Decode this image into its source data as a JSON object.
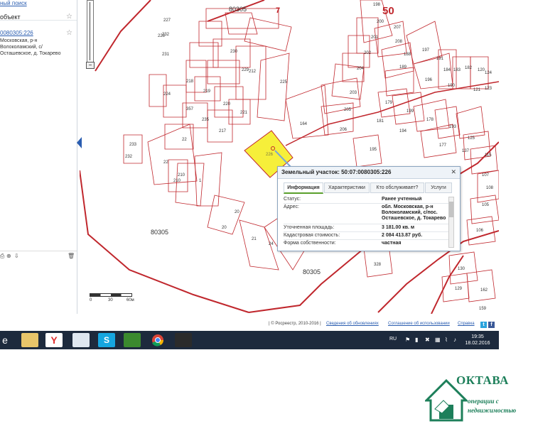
{
  "sidebar": {
    "top_link": "ный поиск",
    "section_title": "объект",
    "object_link": "0080305:226",
    "object_address": "Московская, р-н Волоколамский, с/ Осташевское, д. Токарево",
    "footer_icon_names": [
      "print-icon",
      "zoom-icon",
      "export-icon",
      "delete-icon"
    ]
  },
  "map": {
    "parcels": [
      {
        "label": "227"
      },
      {
        "label": "228"
      },
      {
        "label": "232"
      },
      {
        "label": "231"
      },
      {
        "label": "230"
      },
      {
        "label": "229"
      },
      {
        "label": "212"
      },
      {
        "label": "218"
      },
      {
        "label": "219"
      },
      {
        "label": "220"
      },
      {
        "label": "225"
      },
      {
        "label": "224"
      },
      {
        "label": "357"
      },
      {
        "label": "235"
      },
      {
        "label": "217"
      },
      {
        "label": "221"
      },
      {
        "label": "164"
      },
      {
        "label": "22"
      },
      {
        "label": "22"
      },
      {
        "label": "210"
      },
      {
        "label": "210"
      },
      {
        "label": "1"
      },
      {
        "label": "20"
      },
      {
        "label": "20"
      },
      {
        "label": "233"
      },
      {
        "label": "232"
      },
      {
        "label": "21"
      },
      {
        "label": "24"
      },
      {
        "label": "198"
      },
      {
        "label": "200"
      },
      {
        "label": "201"
      },
      {
        "label": "202"
      },
      {
        "label": "204"
      },
      {
        "label": "203"
      },
      {
        "label": "205"
      },
      {
        "label": "206"
      },
      {
        "label": "207"
      },
      {
        "label": "208"
      },
      {
        "label": "188"
      },
      {
        "label": "189"
      },
      {
        "label": "197"
      },
      {
        "label": "191"
      },
      {
        "label": "196"
      },
      {
        "label": "190"
      },
      {
        "label": "179"
      },
      {
        "label": "199"
      },
      {
        "label": "181"
      },
      {
        "label": "194"
      },
      {
        "label": "178"
      },
      {
        "label": "195"
      },
      {
        "label": "177"
      },
      {
        "label": "125"
      },
      {
        "label": "137"
      },
      {
        "label": "115"
      },
      {
        "label": "105"
      },
      {
        "label": "106"
      },
      {
        "label": "108"
      },
      {
        "label": "107"
      },
      {
        "label": "130"
      },
      {
        "label": "129"
      },
      {
        "label": "162"
      },
      {
        "label": "328"
      },
      {
        "label": "159"
      },
      {
        "label": "120"
      },
      {
        "label": "124"
      },
      {
        "label": "121"
      },
      {
        "label": "123"
      },
      {
        "label": "182"
      },
      {
        "label": "183"
      },
      {
        "label": "184"
      },
      {
        "label": "193"
      }
    ],
    "selected_parcel": "226",
    "quarter_labels": [
      "80305",
      "80305",
      "80305"
    ],
    "zone_labels": [
      "7",
      "50"
    ],
    "highlight_color": "#f6ef3a",
    "line_color": "#c0272d",
    "scale_labels": [
      "0",
      "30",
      "60м"
    ]
  },
  "popup": {
    "title": "Земельный участок: 50:07:0080305:226",
    "tabs": [
      "Информация",
      "Характеристики",
      "Кто обслуживает?",
      "Услуги"
    ],
    "active_tab": "Информация",
    "rows": [
      {
        "label": "Статус:",
        "value": "Ранее учтенный"
      },
      {
        "label": "Адрес:",
        "value": "обл. Московская, р-н Волоколамский, с/пос. Осташевское, д. Токарево"
      },
      {
        "label": "Уточненная площадь:",
        "value": "3 181.00 кв. м"
      },
      {
        "label": "Кадастровая стоимость:",
        "value": "2 084 413.87 руб."
      },
      {
        "label": "Форма собственности:",
        "value": "частная"
      }
    ]
  },
  "footer": {
    "copyright": "| © Росреестр, 2010-2016 |",
    "link1": "Сведения об обновлениях",
    "link2": "Соглашение об использовании",
    "link3": "Справка"
  },
  "taskbar": {
    "language": "RU",
    "time": "19:35",
    "date": "18.02.2016",
    "icons": [
      "windows-icon",
      "explorer-icon",
      "yandex-icon",
      "notepad-icon",
      "skype-icon",
      "icq-icon",
      "chrome-icon",
      "tanks-icon"
    ]
  },
  "watermark": {
    "brand": "ОКТАВА",
    "tagline": "операции с недвижимостью"
  }
}
